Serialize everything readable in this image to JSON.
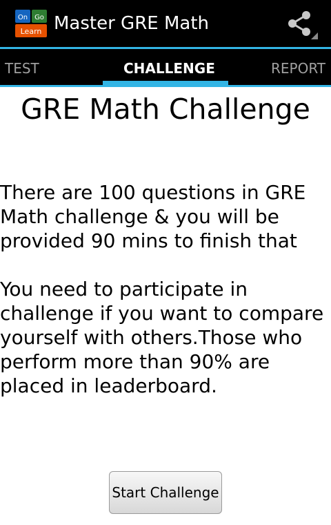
{
  "app_bar": {
    "title": "Master GRE Math",
    "logo_text": [
      "On",
      "Go",
      "Learn"
    ],
    "logo_colors": [
      "#1565c0",
      "#2e7d32",
      "#e65100"
    ],
    "share_icon": "share-icon"
  },
  "tabs": [
    {
      "label": "TEST",
      "active": false
    },
    {
      "label": "CHALLENGE",
      "active": true
    },
    {
      "label": "REPORT",
      "active": false
    }
  ],
  "accent_color": "#33b5e5",
  "content": {
    "title": "GRE Math Challenge",
    "paragraph1": [
      "There are 100 questions in GRE",
      "Math challenge & you will be",
      "provided 90 mins to finish that"
    ],
    "paragraph2": [
      "You need to participate in",
      "challenge if you want to compare",
      "yourself with others.Those who",
      "perform more than 90% are",
      "placed in leaderboard."
    ],
    "start_button": "Start Challenge"
  }
}
